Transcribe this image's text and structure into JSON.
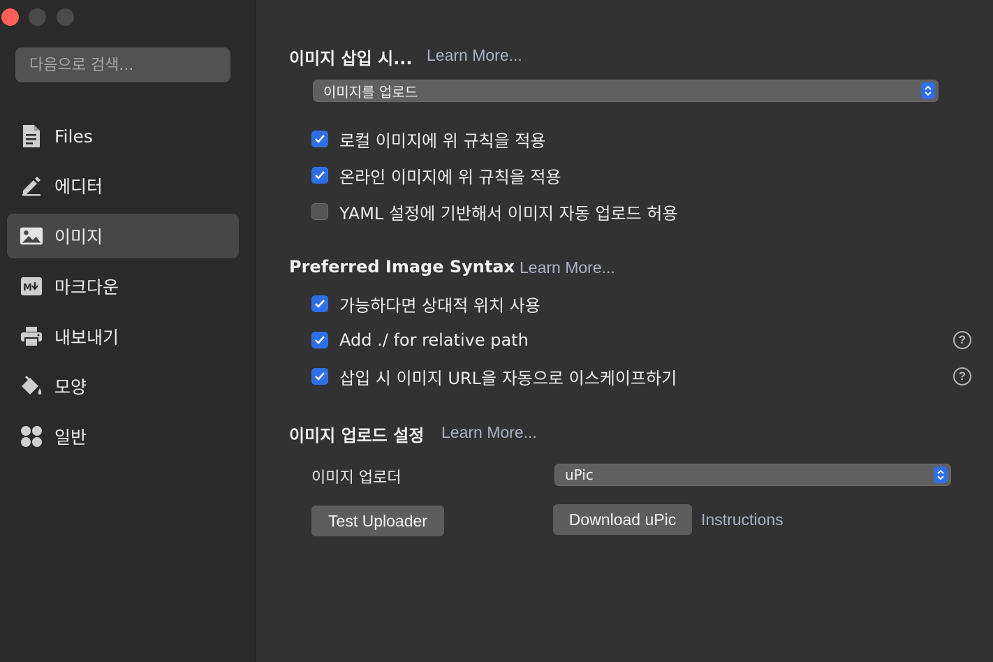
{
  "window": {
    "traffic_lights": [
      "close",
      "minimize",
      "zoom"
    ]
  },
  "sidebar": {
    "search_placeholder": "다음으로 검색...",
    "items": [
      {
        "label": "Files",
        "icon": "document-icon",
        "active": false
      },
      {
        "label": "에디터",
        "icon": "pencil-icon",
        "active": false
      },
      {
        "label": "이미지",
        "icon": "image-icon",
        "active": true
      },
      {
        "label": "마크다운",
        "icon": "markdown-icon",
        "active": false
      },
      {
        "label": "내보내기",
        "icon": "printer-icon",
        "active": false
      },
      {
        "label": "모양",
        "icon": "paint-bucket-icon",
        "active": false
      },
      {
        "label": "일반",
        "icon": "grid-dots-icon",
        "active": false
      }
    ]
  },
  "insert_section": {
    "title": "이미지 삽입 시...",
    "learn_more": "Learn More...",
    "select_value": "이미지를 업로드",
    "checks": [
      {
        "label": "로컬 이미지에 위 규칙을 적용",
        "checked": true
      },
      {
        "label": "온라인 이미지에 위 규칙을 적용",
        "checked": true
      },
      {
        "label": "YAML 설정에 기반해서 이미지 자동 업로드 허용",
        "checked": false
      }
    ]
  },
  "syntax_section": {
    "title": "Preferred Image Syntax",
    "learn_more": "Learn More...",
    "checks": [
      {
        "label": "가능하다면 상대적 위치 사용",
        "checked": true
      },
      {
        "label": "Add ./ for relative path",
        "checked": true
      },
      {
        "label": "삽입 시 이미지 URL을 자동으로 이스케이프하기",
        "checked": true
      }
    ],
    "help_symbol": "?"
  },
  "upload_section": {
    "title": "이미지 업로드 설정",
    "learn_more": "Learn More...",
    "uploader_label": "이미지 업로더",
    "uploader_value": "uPic",
    "test_button": "Test Uploader",
    "download_button": "Download uPic",
    "instructions_link": "Instructions"
  },
  "colors": {
    "accent": "#2f6fe6",
    "close": "#fe5f57",
    "link": "#a8b3c6"
  }
}
